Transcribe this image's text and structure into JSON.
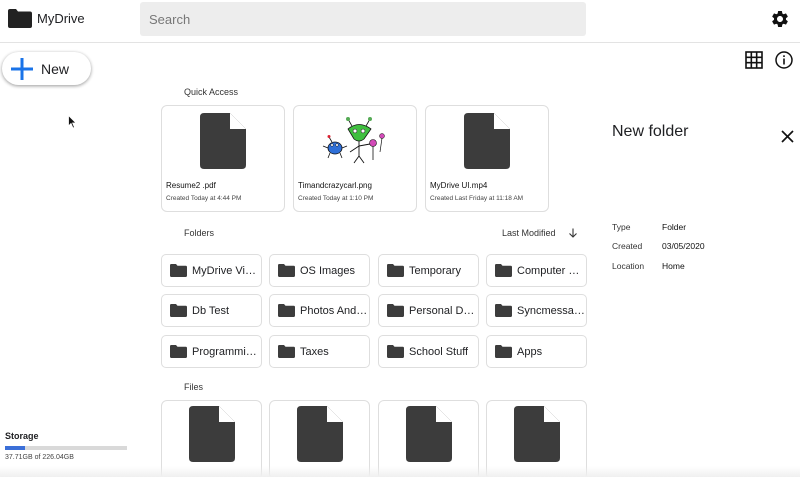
{
  "header": {
    "app_name": "MyDrive",
    "search_placeholder": "Search"
  },
  "sidebar": {
    "new_label": "New",
    "storage": {
      "title": "Storage",
      "usage_text": "37.71GB of 226.04GB",
      "fraction": 0.1668
    }
  },
  "main": {
    "quick_access_label": "Quick Access",
    "quick_access": [
      {
        "name": "Resume2 .pdf",
        "meta": "Created Today at 4:44 PM",
        "icon": "document-icon"
      },
      {
        "name": "Timandcrazycarl.png",
        "meta": "Created Today at 1:10 PM",
        "icon": "image-thumbnail"
      },
      {
        "name": "MyDrive UI.mp4",
        "meta": "Created Last Friday at 11:18 AM",
        "icon": "document-icon"
      }
    ],
    "folders_label": "Folders",
    "sort_label": "Last Modified",
    "folders": [
      "MyDrive Vid…",
      "OS Images",
      "Temporary",
      "Computer R…",
      "Db Test",
      "Photos And …",
      "Personal Dri…",
      "Syncmessage",
      "Programmin…",
      "Taxes",
      "School Stuff",
      "Apps"
    ],
    "files_label": "Files"
  },
  "details": {
    "title": "New folder",
    "rows": [
      {
        "key": "Type",
        "value": "Folder"
      },
      {
        "key": "Created",
        "value": "03/05/2020"
      },
      {
        "key": "Location",
        "value": "Home"
      }
    ]
  },
  "colors": {
    "accent_blue": "#1a73e8",
    "storage_fill": "#3b6fd8",
    "icon_dark": "#3c3c3c"
  }
}
